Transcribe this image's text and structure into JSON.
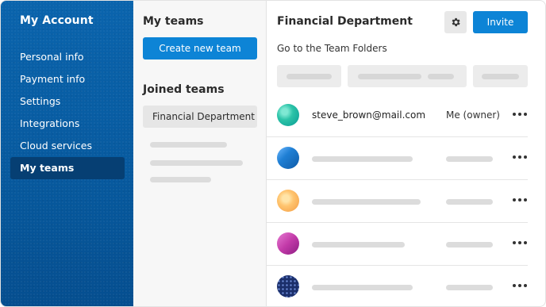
{
  "sidebar": {
    "title": "My Account",
    "items": [
      {
        "label": "Personal info"
      },
      {
        "label": "Payment info"
      },
      {
        "label": "Settings"
      },
      {
        "label": "Integrations"
      },
      {
        "label": "Cloud services"
      },
      {
        "label": "My teams",
        "active": true
      }
    ],
    "colors": {
      "background": "#075a9f",
      "active": "#063f73"
    }
  },
  "teams": {
    "title": "My teams",
    "create_label": "Create new team",
    "joined_title": "Joined teams",
    "joined": [
      {
        "label": "Financial Department"
      }
    ]
  },
  "team": {
    "title": "Financial Department",
    "settings_icon": "gear-icon",
    "invite_label": "Invite",
    "folders_link": "Go to the Team Folders",
    "members": [
      {
        "email": "steve_brown@mail.com",
        "role": "Me (owner)",
        "avatar": "teal"
      },
      {
        "email": "",
        "role": "",
        "avatar": "blue"
      },
      {
        "email": "",
        "role": "",
        "avatar": "orange"
      },
      {
        "email": "",
        "role": "",
        "avatar": "pink"
      },
      {
        "email": "",
        "role": "",
        "avatar": "navy"
      }
    ],
    "more_icon": "more-horizontal-icon"
  },
  "colors": {
    "accent": "#0d84d6",
    "placeholder": "#dcdcdc"
  }
}
